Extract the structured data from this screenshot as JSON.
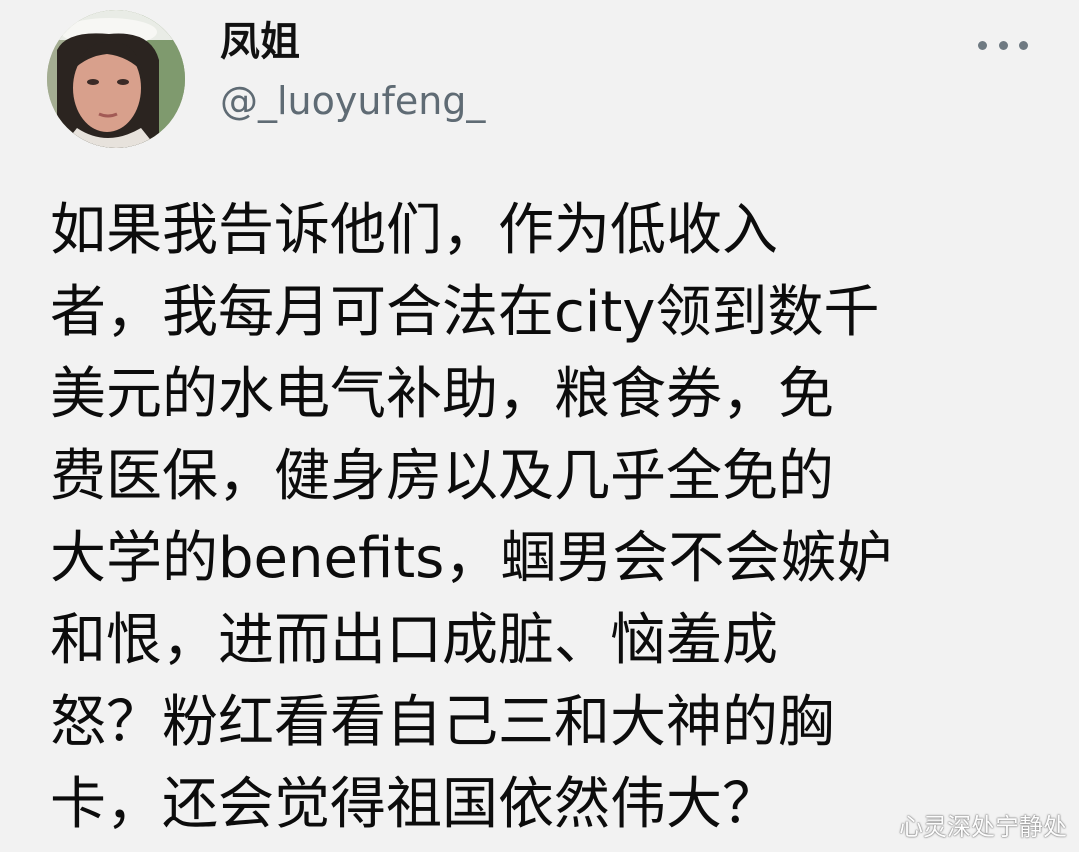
{
  "tweet": {
    "author": {
      "display_name": "凤姐",
      "handle": "@_luoyufeng_"
    },
    "more_icon": "more-horizontal-icon",
    "body_lines": [
      "如果我告诉他们，作为低收入",
      "者，我每月可合法在city领到数千",
      "美元的水电气补助，粮食券，免",
      "费医保，健身房以及几乎全免的",
      "大学的benefits，蝈男会不会嫉妒",
      "和恨，进而出口成脏、恼羞成",
      "怒？粉红看看自己三和大神的胸",
      "卡，还会觉得祖国依然伟大？"
    ]
  },
  "watermark": "心灵深处宁静处",
  "colors": {
    "background": "#f2f2f2",
    "text": "#0c0c0c",
    "handle": "#5f6b74"
  }
}
